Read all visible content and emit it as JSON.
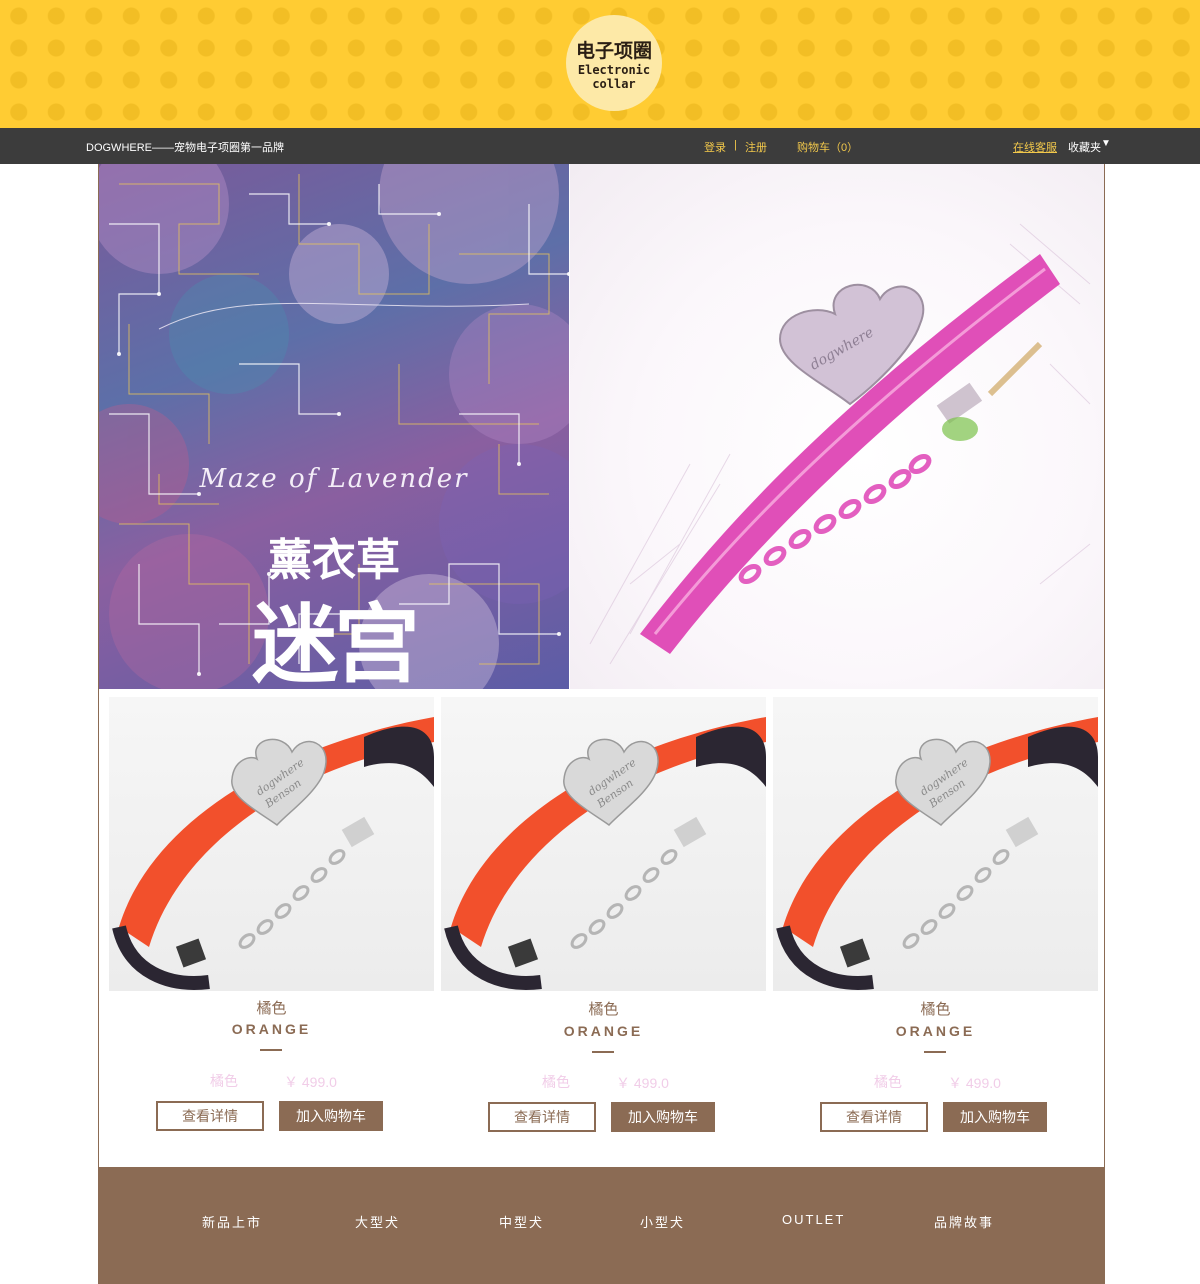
{
  "header": {
    "logo_cn": "电子项圈",
    "logo_en_1": "Electronic",
    "logo_en_2": "collar"
  },
  "topnav": {
    "slogan": "DOGWHERE——宠物电子项圈第一品牌",
    "login": "登录",
    "separator": "|",
    "register": "注册",
    "cart": "购物车（0）",
    "service": "在线客服",
    "favorites": "收藏夹",
    "favorites_arrow": "▼"
  },
  "hero": {
    "script_text": "Maze of Lavender",
    "title_cn_1": "薰衣草",
    "title_cn_2": "迷宫",
    "collar_engraving": "dogwhere"
  },
  "products": [
    {
      "name_cn": "橘色",
      "name_en": "ORANGE",
      "price_label": "橘色",
      "price": "￥ 499.0",
      "detail_label": "查看详情",
      "cart_label": "加入购物车",
      "engraving_1": "dogwhere",
      "engraving_2": "Benson"
    },
    {
      "name_cn": "橘色",
      "name_en": "ORANGE",
      "price_label": "橘色",
      "price": "￥ 499.0",
      "detail_label": "查看详情",
      "cart_label": "加入购物车",
      "engraving_1": "dogwhere",
      "engraving_2": "Benson"
    },
    {
      "name_cn": "橘色",
      "name_en": "ORANGE",
      "price_label": "橘色",
      "price": "￥ 499.0",
      "detail_label": "查看详情",
      "cart_label": "加入购物车",
      "engraving_1": "dogwhere",
      "engraving_2": "Benson"
    }
  ],
  "footer": {
    "items": [
      "新品上市",
      "大型犬",
      "中型犬",
      "小型犬",
      "OUTLET",
      "品牌故事"
    ]
  },
  "colors": {
    "banner_yellow": "#ffcc33",
    "nav_dark": "#3c3c3c",
    "accent_brown": "#8b6b54",
    "link_gold": "#f2c84b",
    "price_pink": "#f1cde8",
    "collar_orange": "#f2502c",
    "collar_pink": "#e04fb8"
  }
}
